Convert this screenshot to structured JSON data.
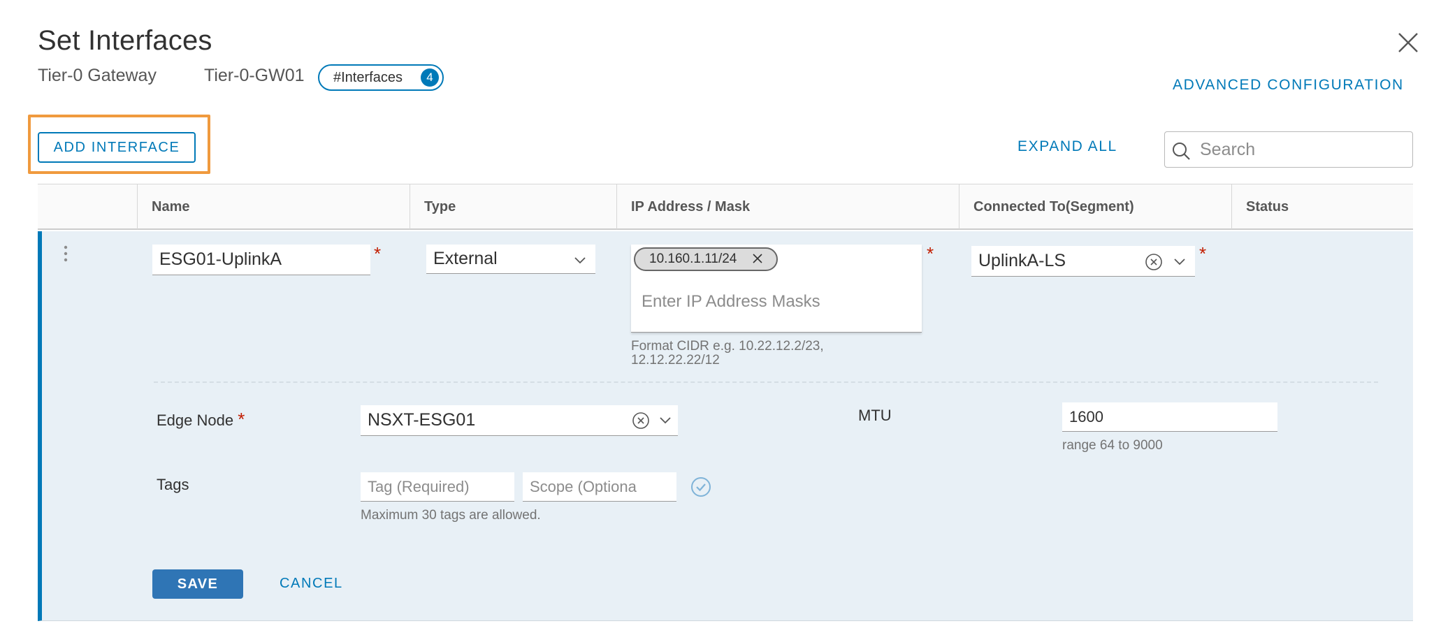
{
  "dialog": {
    "title": "Set Interfaces",
    "gateway_label": "Tier-0 Gateway",
    "gateway_name": "Tier-0-GW01",
    "interfaces_badge": {
      "label": "#Interfaces",
      "count": "4"
    },
    "advanced_configuration": "ADVANCED CONFIGURATION",
    "close": "close-icon"
  },
  "toolbar": {
    "add_interface": "ADD INTERFACE",
    "expand_all": "EXPAND ALL",
    "search_placeholder": "Search"
  },
  "table": {
    "columns": [
      "Name",
      "Type",
      "IP Address / Mask",
      "Connected To(Segment)",
      "Status"
    ]
  },
  "row": {
    "name": "ESG01-UplinkA",
    "type": "External",
    "ip_chip": "10.160.1.11/24",
    "ip_placeholder": "Enter IP Address Masks",
    "ip_help_line1": "Format CIDR e.g. 10.22.12.2/23,",
    "ip_help_line2": "12.12.22.22/12",
    "segment": "UplinkA-LS",
    "status": ""
  },
  "details": {
    "edge_node_label": "Edge Node",
    "edge_node_value": "NSXT-ESG01",
    "mtu_label": "MTU",
    "mtu_value": "1600",
    "mtu_help": "range 64 to 9000",
    "tags_label": "Tags",
    "tag_placeholder": "Tag (Required)",
    "scope_placeholder": "Scope (Optiona",
    "tags_help": "Maximum 30 tags are allowed."
  },
  "actions": {
    "save": "SAVE",
    "cancel": "CANCEL"
  },
  "colors": {
    "accent": "#0079b8",
    "highlight": "#f09a3e",
    "required": "#c21d00",
    "row_bg": "#e8f0f6",
    "save_bg": "#2f75b5"
  }
}
